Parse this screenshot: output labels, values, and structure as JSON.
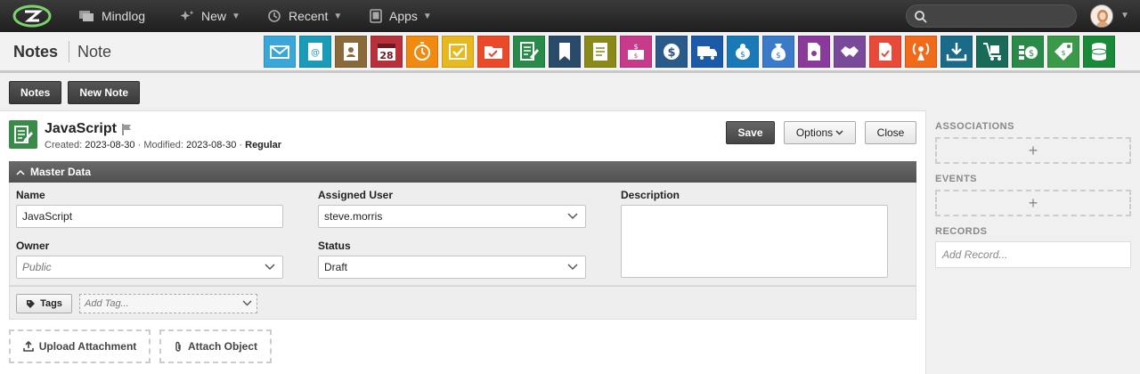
{
  "topnav": {
    "logo": "zurmo-logo",
    "home_label": "Mindlog",
    "new_label": "New",
    "recent_label": "Recent",
    "apps_label": "Apps"
  },
  "search": {
    "placeholder": ""
  },
  "breadcrumb": {
    "module": "Notes",
    "current": "Note"
  },
  "modules": [
    {
      "name": "email-module",
      "color": "#3aa7d8"
    },
    {
      "name": "contacts-module",
      "color": "#1a9bb8"
    },
    {
      "name": "people-module",
      "color": "#8a6a3a"
    },
    {
      "name": "calendar-module",
      "color": "#b8303a",
      "text": "28"
    },
    {
      "name": "timer-module",
      "color": "#f08a10"
    },
    {
      "name": "tasks-module",
      "color": "#e8b820"
    },
    {
      "name": "folders-module",
      "color": "#e84a2a"
    },
    {
      "name": "notes-module",
      "color": "#2a8a4a"
    },
    {
      "name": "bookmarks-module",
      "color": "#2a4a6a"
    },
    {
      "name": "documents-module",
      "color": "#8a8a1a"
    },
    {
      "name": "accounts-module",
      "color": "#c83a8a"
    },
    {
      "name": "finance-module",
      "color": "#2a5a8a"
    },
    {
      "name": "shipping-module",
      "color": "#1a5aa8"
    },
    {
      "name": "savings-module",
      "color": "#1a7ab8"
    },
    {
      "name": "moneybag-module",
      "color": "#3a7ac8"
    },
    {
      "name": "contracts-module",
      "color": "#8a3a9a"
    },
    {
      "name": "deals-module",
      "color": "#7a4a9a"
    },
    {
      "name": "forms-module",
      "color": "#e84a3a"
    },
    {
      "name": "broadcast-module",
      "color": "#f06a1a"
    },
    {
      "name": "downloads-module",
      "color": "#1a6a8a"
    },
    {
      "name": "inventory-module",
      "color": "#1a6a5a"
    },
    {
      "name": "payments-module",
      "color": "#2a8a4a"
    },
    {
      "name": "products-module",
      "color": "#3a9a4a"
    },
    {
      "name": "database-module",
      "color": "#1a8a3a"
    }
  ],
  "buttons": {
    "notes": "Notes",
    "new_note": "New Note",
    "save": "Save",
    "options": "Options",
    "close": "Close"
  },
  "record": {
    "title": "JavaScript",
    "created_label": "Created:",
    "created": "2023-08-30",
    "sep": "·",
    "modified_label": "Modified:",
    "modified": "2023-08-30",
    "type": "Regular"
  },
  "section": {
    "title": "Master Data"
  },
  "fields": {
    "name_label": "Name",
    "name_value": "JavaScript",
    "assigned_label": "Assigned User",
    "assigned_value": "steve.morris",
    "description_label": "Description",
    "owner_label": "Owner",
    "owner_placeholder": "Public",
    "status_label": "Status",
    "status_value": "Draft"
  },
  "tags": {
    "label": "Tags",
    "placeholder": "Add Tag..."
  },
  "attachments": {
    "upload": "Upload Attachment",
    "attach": "Attach Object"
  },
  "sidebar": {
    "associations": "ASSOCIATIONS",
    "events": "EVENTS",
    "records": "RECORDS",
    "records_placeholder": "Add Record...",
    "add_symbol": "+"
  }
}
